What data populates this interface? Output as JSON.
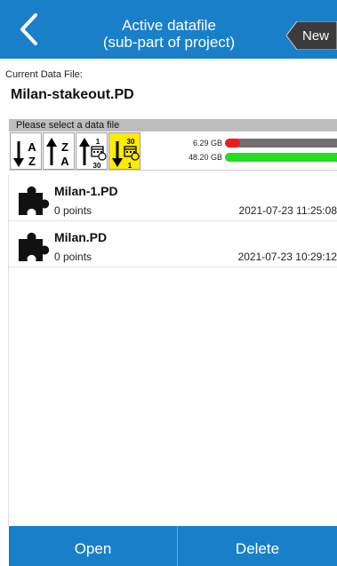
{
  "header": {
    "title_line1": "Active datafile",
    "title_line2": "(sub-part of project)",
    "new_label": "New",
    "back_icon": "chevron-left-icon",
    "color": "#1a7fc9"
  },
  "current": {
    "label": "Current Data File:",
    "file": "Milan-stakeout.PD"
  },
  "select_prompt": "Please select a data file",
  "sort_buttons": [
    {
      "name": "sort-name-ascending",
      "icon": "sort-a-z-icon",
      "top": "A",
      "bottom": "Z",
      "active": false
    },
    {
      "name": "sort-name-descending",
      "icon": "sort-z-a-icon",
      "top": "Z",
      "bottom": "A",
      "active": false
    },
    {
      "name": "sort-date-ascending",
      "icon": "sort-date-1-30-icon",
      "top": "1",
      "bottom": "30",
      "active": false
    },
    {
      "name": "sort-date-descending",
      "icon": "sort-date-30-1-icon",
      "top": "30",
      "bottom": "1",
      "active": true
    }
  ],
  "storage": [
    {
      "value": "6.29 GB",
      "fill": 0.12,
      "color": "#ee1c1c"
    },
    {
      "value": "48.20 GB",
      "fill": 0.92,
      "color": "#22dd22"
    }
  ],
  "files": [
    {
      "name": "Milan-1.PD",
      "points": "0 points",
      "date": "2021-07-23 11:25:08",
      "icon": "puzzle-icon"
    },
    {
      "name": "Milan.PD",
      "points": "0 points",
      "date": "2021-07-23 10:29:12",
      "icon": "puzzle-icon"
    }
  ],
  "footer": {
    "open_label": "Open",
    "delete_label": "Delete"
  }
}
